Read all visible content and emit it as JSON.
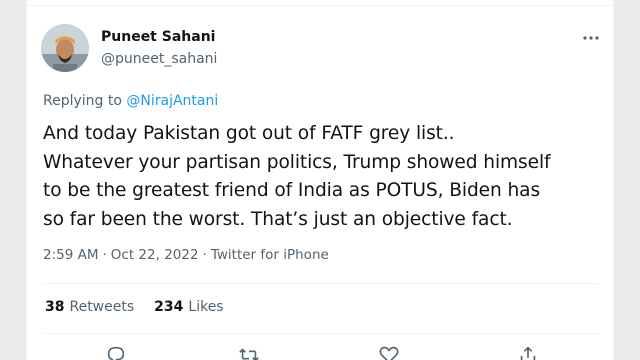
{
  "author": {
    "name": "Puneet Sahani",
    "handle": "@puneet_sahani"
  },
  "reply": {
    "prefix": "Replying to ",
    "mention": "@NirajAntani"
  },
  "tweet": {
    "lines": [
      "And today Pakistan got out of FATF grey list..",
      "Whatever your partisan politics, Trump showed himself",
      "to be the greatest friend of India as POTUS, Biden has",
      "so far been the worst. That’s just an objective fact."
    ],
    "time": "2:59 AM",
    "date": "Oct 22, 2022",
    "source": "Twitter for iPhone",
    "separator": "·"
  },
  "stats": {
    "retweets_count": "38",
    "retweets_label": "Retweets",
    "likes_count": "234",
    "likes_label": "Likes"
  },
  "icons": {
    "more": "more-icon",
    "reply": "reply-icon",
    "retweet": "retweet-icon",
    "like": "like-icon",
    "share": "share-icon"
  },
  "colors": {
    "accent": "#1d9bf0",
    "secondary_text": "#536471",
    "primary_text": "#0f1419",
    "divider": "#eff3f4"
  }
}
